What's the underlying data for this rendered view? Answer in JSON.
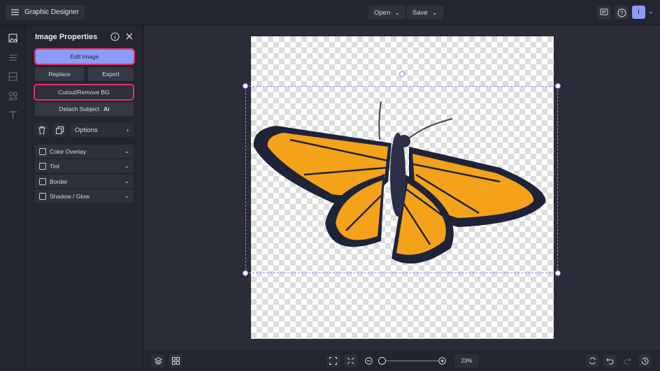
{
  "app": {
    "title": "Graphic Designer",
    "user_initial": "I"
  },
  "topbar": {
    "open_label": "Open",
    "save_label": "Save"
  },
  "panel": {
    "title": "Image Properties",
    "edit_image": "Edit Image",
    "replace": "Replace",
    "export": "Export",
    "cutout": "Cutout/Remove BG",
    "detach": "Detach Subject",
    "ai_badge": "Ai",
    "options": "Options",
    "accordions": [
      {
        "label": "Color Overlay"
      },
      {
        "label": "Tint"
      },
      {
        "label": "Border"
      },
      {
        "label": "Shadow / Glow"
      }
    ]
  },
  "zoom": {
    "value": "23%",
    "level_percent": 23
  },
  "colors": {
    "accent": "#8c9cf8",
    "highlight": "#e2356f"
  }
}
